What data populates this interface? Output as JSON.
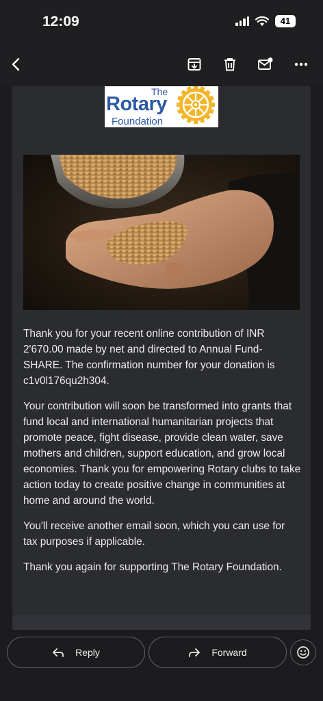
{
  "status_bar": {
    "time": "12:09",
    "battery": "41",
    "icons": [
      "signal-icon",
      "wifi-icon",
      "battery-icon"
    ]
  },
  "app_bar": {
    "icons": [
      "back-arrow-icon",
      "archive-icon",
      "trash-icon",
      "mark-unread-icon",
      "more-vert-icon"
    ]
  },
  "logo": {
    "the": "The",
    "rotary": "Rotary",
    "foundation": "Foundation",
    "color": "#2d59a5",
    "wheel_color": "#f3b62b"
  },
  "email": {
    "paragraphs": [
      "Thank you for your recent online contribution of INR 2'670.00 made by net and directed to Annual Fund-SHARE. The confirmation number for your donation is c1v0l176qu2h304.",
      "Your contribution will soon be transformed into grants that fund local and international humanitarian projects that promote peace, fight disease, provide clean water, save mothers and children, support education, and grow local economies. Thank you for empowering Rotary clubs to take action today to create positive change in communities at home and around the world.",
      "You'll receive another email soon, which you can use for tax purposes if applicable.",
      "Thank you again for supporting The Rotary Foundation."
    ]
  },
  "actions": {
    "reply_label": "Reply",
    "forward_label": "Forward",
    "icons": [
      "reply-icon",
      "forward-icon",
      "emoji-icon"
    ]
  }
}
